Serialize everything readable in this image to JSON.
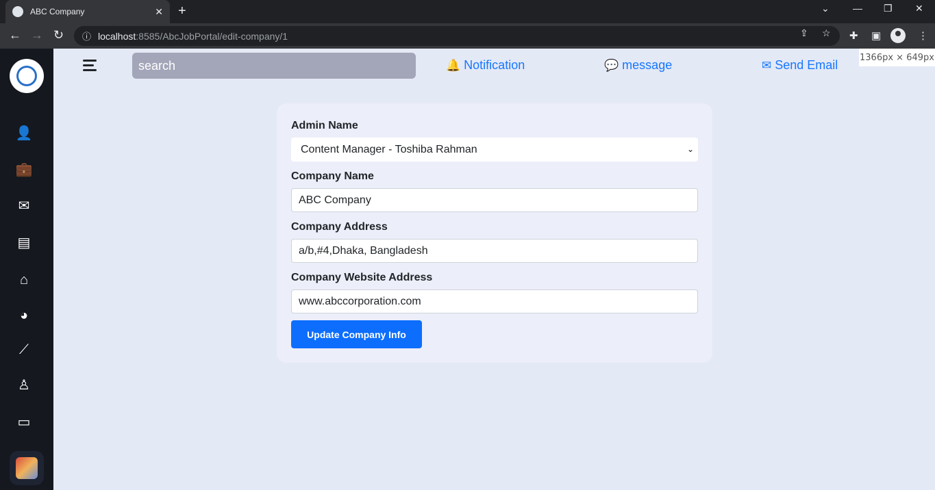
{
  "browser": {
    "tab_title": "ABC Company",
    "tab_close": "✕",
    "new_tab": "+",
    "url_host": "localhost",
    "url_path": ":8585/AbcJobPortal/edit-company/1",
    "window_controls": [
      "⌄",
      "—",
      "❐",
      "✕"
    ]
  },
  "size_badge": "1366px × 649px",
  "topbar": {
    "search_placeholder": "search",
    "links": [
      {
        "label": "Notification",
        "icon": "bell-icon"
      },
      {
        "label": "message",
        "icon": "comments-icon"
      },
      {
        "label": "Send Email",
        "icon": "envelope-check-icon"
      }
    ]
  },
  "sidebar": {
    "icons": [
      "user-shield-icon",
      "briefcase-clock-icon",
      "envelope-check-icon",
      "chalkboard-user-icon",
      "house-laptop-icon",
      "chart-pie-icon",
      "chart-line-icon",
      "user-tie-icon",
      "address-card-icon"
    ]
  },
  "form": {
    "admin_label": "Admin Name",
    "admin_value": "Content Manager - Toshiba Rahman",
    "company_label": "Company Name",
    "company_value": "ABC Company",
    "address_label": "Company Address",
    "address_value": "a/b,#4,Dhaka, Bangladesh",
    "website_label": "Company Website Address",
    "website_value": "www.abccorporation.com",
    "submit_label": "Update Company Info"
  },
  "colors": {
    "accent": "#0d6efd",
    "link": "#1677ff",
    "sidebar": "#15181f",
    "page_bg": "#e4e9f6"
  }
}
